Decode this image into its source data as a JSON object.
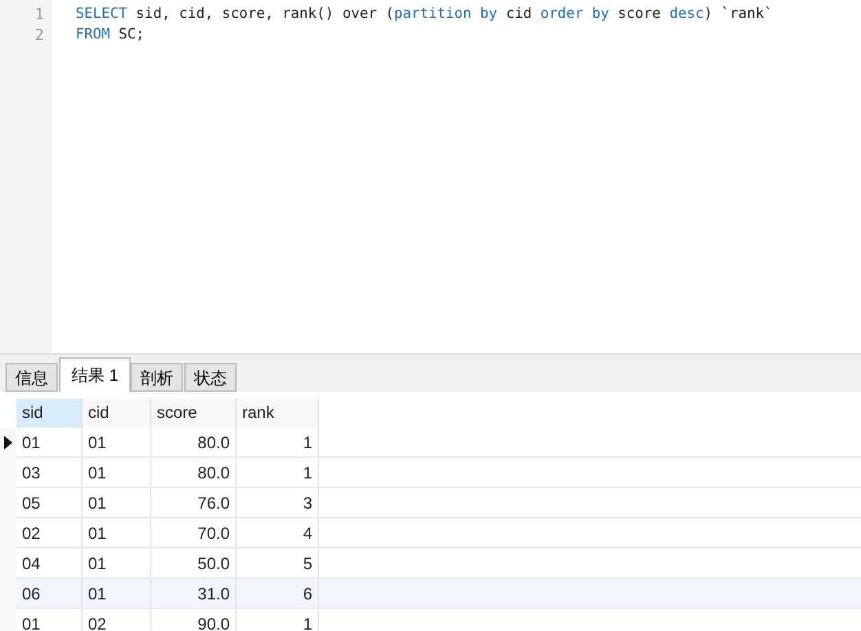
{
  "editor": {
    "lines": [
      {
        "number": "1",
        "tokens": [
          {
            "text": "SELECT",
            "kind": "keyword"
          },
          {
            "text": " sid, cid, score, rank() over (",
            "kind": "plain"
          },
          {
            "text": "partition by",
            "kind": "keyword"
          },
          {
            "text": " cid ",
            "kind": "plain"
          },
          {
            "text": "order by",
            "kind": "keyword"
          },
          {
            "text": " score ",
            "kind": "plain"
          },
          {
            "text": "desc",
            "kind": "keyword"
          },
          {
            "text": ") `rank`",
            "kind": "plain"
          }
        ]
      },
      {
        "number": "2",
        "tokens": [
          {
            "text": "FROM",
            "kind": "keyword"
          },
          {
            "text": " SC;",
            "kind": "plain"
          }
        ]
      }
    ]
  },
  "tabs": [
    {
      "label": "信息",
      "selected": false
    },
    {
      "label": "结果 1",
      "selected": true
    },
    {
      "label": "剖析",
      "selected": false
    },
    {
      "label": "状态",
      "selected": false
    }
  ],
  "table": {
    "columns": [
      {
        "label": "sid",
        "selected": true
      },
      {
        "label": "cid",
        "selected": false
      },
      {
        "label": "score",
        "selected": false
      },
      {
        "label": "rank",
        "selected": false
      }
    ],
    "rows": [
      {
        "selected": true,
        "hovered": false,
        "cells": [
          "01",
          "01",
          "80.0",
          "1"
        ]
      },
      {
        "selected": false,
        "hovered": false,
        "cells": [
          "03",
          "01",
          "80.0",
          "1"
        ]
      },
      {
        "selected": false,
        "hovered": false,
        "cells": [
          "05",
          "01",
          "76.0",
          "3"
        ]
      },
      {
        "selected": false,
        "hovered": false,
        "cells": [
          "02",
          "01",
          "70.0",
          "4"
        ]
      },
      {
        "selected": false,
        "hovered": false,
        "cells": [
          "04",
          "01",
          "50.0",
          "5"
        ]
      },
      {
        "selected": false,
        "hovered": true,
        "cells": [
          "06",
          "01",
          "31.0",
          "6"
        ]
      },
      {
        "selected": false,
        "hovered": false,
        "cells": [
          "01",
          "02",
          "90.0",
          "1"
        ]
      }
    ]
  }
}
